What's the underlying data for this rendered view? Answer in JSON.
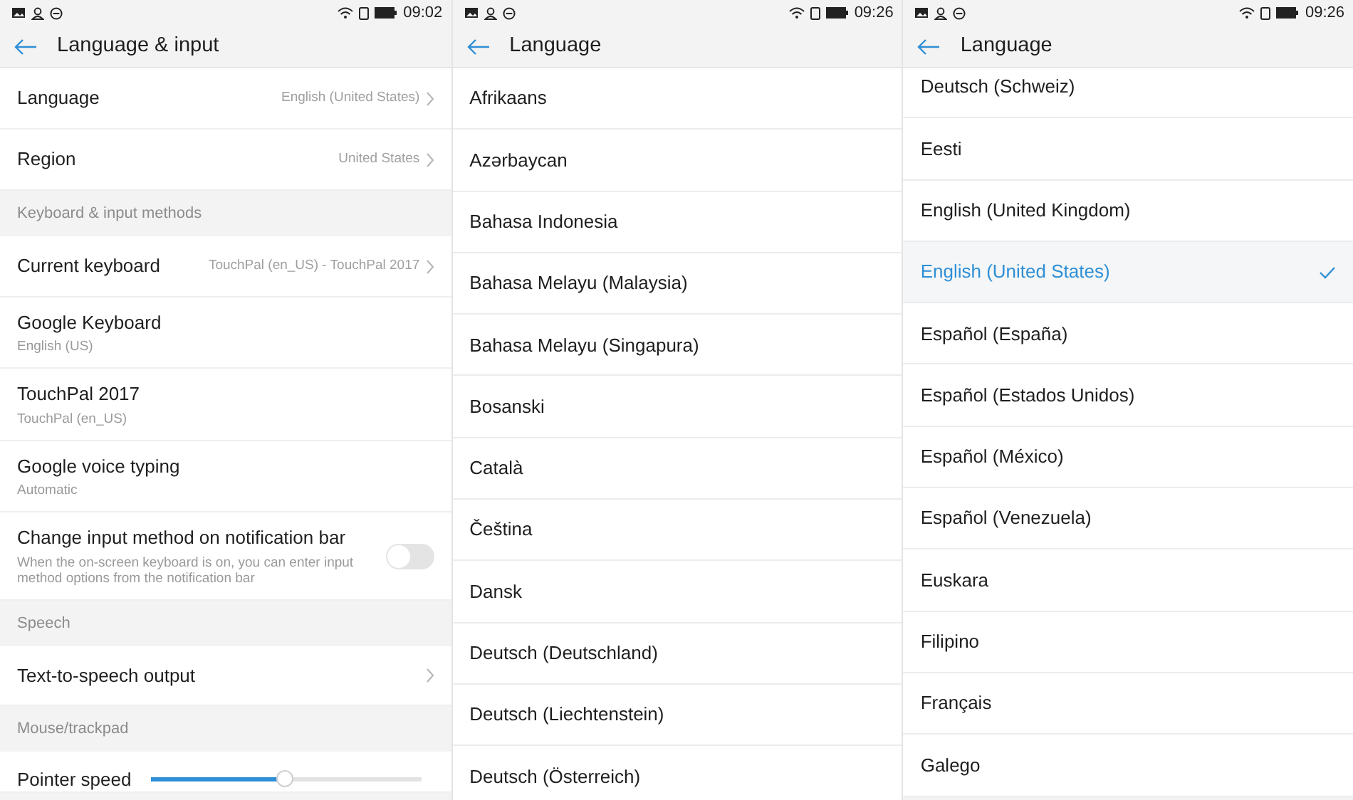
{
  "screens": [
    {
      "status_bar": {
        "time": "09:02"
      },
      "title": "Language & input",
      "items": [
        {
          "kind": "nav",
          "label": "Language",
          "value": "English (United States)"
        },
        {
          "kind": "nav",
          "label": "Region",
          "value": "United States"
        },
        {
          "kind": "section",
          "label": "Keyboard & input methods"
        },
        {
          "kind": "nav",
          "label": "Current keyboard",
          "value": "TouchPal (en_US) - TouchPal 2017"
        },
        {
          "kind": "detail",
          "label": "Google Keyboard",
          "summary": "English (US)"
        },
        {
          "kind": "detail",
          "label": "TouchPal 2017",
          "summary": "TouchPal (en_US)"
        },
        {
          "kind": "detail",
          "label": "Google voice typing",
          "summary": "Automatic"
        },
        {
          "kind": "switch",
          "label": "Change input method on notification bar",
          "summary": "When the on-screen keyboard is on, you can enter input method options from the notification bar",
          "on": false
        },
        {
          "kind": "section",
          "label": "Speech"
        },
        {
          "kind": "nav",
          "label": "Text-to-speech output"
        },
        {
          "kind": "section",
          "label": "Mouse/trackpad"
        },
        {
          "kind": "slider",
          "label": "Pointer speed",
          "level": 0.5
        }
      ]
    },
    {
      "status_bar": {
        "time": "09:26"
      },
      "title": "Language",
      "items": [
        {
          "kind": "option",
          "label": "Afrikaans",
          "selected": false
        },
        {
          "kind": "option",
          "label": "Azərbaycan",
          "selected": false
        },
        {
          "kind": "option",
          "label": "Bahasa Indonesia",
          "selected": false
        },
        {
          "kind": "option",
          "label": "Bahasa Melayu (Malaysia)",
          "selected": false
        },
        {
          "kind": "option",
          "label": "Bahasa Melayu (Singapura)",
          "selected": false
        },
        {
          "kind": "option",
          "label": "Bosanski",
          "selected": false
        },
        {
          "kind": "option",
          "label": "Català",
          "selected": false
        },
        {
          "kind": "option",
          "label": "Čeština",
          "selected": false
        },
        {
          "kind": "option",
          "label": "Dansk",
          "selected": false
        },
        {
          "kind": "option",
          "label": "Deutsch (Deutschland)",
          "selected": false
        },
        {
          "kind": "option",
          "label": "Deutsch (Liechtenstein)",
          "selected": false
        },
        {
          "kind": "option",
          "label": "Deutsch (Österreich)",
          "selected": false
        }
      ]
    },
    {
      "status_bar": {
        "time": "09:26"
      },
      "title": "Language",
      "items": [
        {
          "kind": "option",
          "label": "Deutsch (Schweiz)",
          "selected": false
        },
        {
          "kind": "option",
          "label": "Eesti",
          "selected": false
        },
        {
          "kind": "option",
          "label": "English (United Kingdom)",
          "selected": false
        },
        {
          "kind": "option",
          "label": "English (United States)",
          "selected": true
        },
        {
          "kind": "option",
          "label": "Español (España)",
          "selected": false
        },
        {
          "kind": "option",
          "label": "Español (Estados Unidos)",
          "selected": false
        },
        {
          "kind": "option",
          "label": "Español (México)",
          "selected": false
        },
        {
          "kind": "option",
          "label": "Español (Venezuela)",
          "selected": false
        },
        {
          "kind": "option",
          "label": "Euskara",
          "selected": false
        },
        {
          "kind": "option",
          "label": "Filipino",
          "selected": false
        },
        {
          "kind": "option",
          "label": "Français",
          "selected": false
        },
        {
          "kind": "option",
          "label": "Galego",
          "selected": false
        }
      ]
    }
  ]
}
